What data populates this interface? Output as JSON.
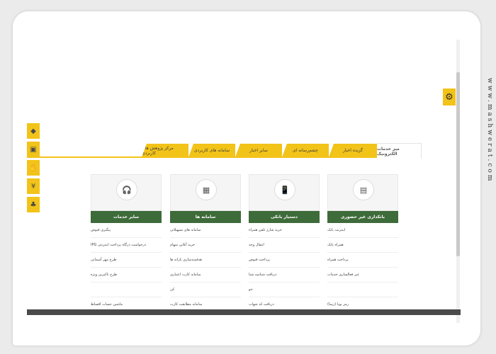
{
  "watermark": "www.mashwerat.com",
  "tabs": [
    {
      "label": "میز خدمات الکترونیک",
      "active": true
    },
    {
      "label": "گزیده اخبار"
    },
    {
      "label": "چشم‌رسانه ای"
    },
    {
      "label": "سایر اخبار"
    },
    {
      "label": "سامانه های کاربردی"
    },
    {
      "label": "مرکز پژوهش های کاربردی"
    }
  ],
  "columns": [
    {
      "title": "بانکداری غیر حضوری",
      "icon": "pos-terminal-icon",
      "items": [
        "اینترنت بانک",
        "همراه بانک",
        "پرداخت همراه",
        "غیر فعالسازی خدمات",
        "",
        "رمز پویا (زیما)"
      ]
    },
    {
      "title": "دستیار بانکی",
      "icon": "mobile-hand-icon",
      "items": [
        "خرید شارژ تلفن همراه",
        "انتقال وجه",
        "پرداخت قبوض",
        "دریافت شناسه شبا",
        "جو",
        "دریافت کد شهاب"
      ]
    },
    {
      "title": "سامانه ها",
      "icon": "calculator-icon",
      "items": [
        "سامانه های تسهیلاتی",
        "خرید آنلاین سهام",
        "هدفمندسازی یارانه ها",
        "سامانه کارت اعتباری",
        "کن",
        "سامانه مطابقت کارت"
      ]
    },
    {
      "title": "سایر خدمات",
      "icon": "headset-icon",
      "items": [
        "پیگیری قبوض",
        "درخواست درگاه پرداخت اینترنتی IPG",
        "طرح مهر آسمانی",
        "طرح تاکیرین ویژه",
        "",
        "ماشین حساب اقساط"
      ]
    }
  ],
  "side_icons": [
    "coin-icon",
    "wallet-icon",
    "handshake-icon",
    "hand-coin-icon",
    "plant-icon"
  ],
  "colors": {
    "accent": "#f2c318",
    "header_green": "#3e6b3a"
  }
}
